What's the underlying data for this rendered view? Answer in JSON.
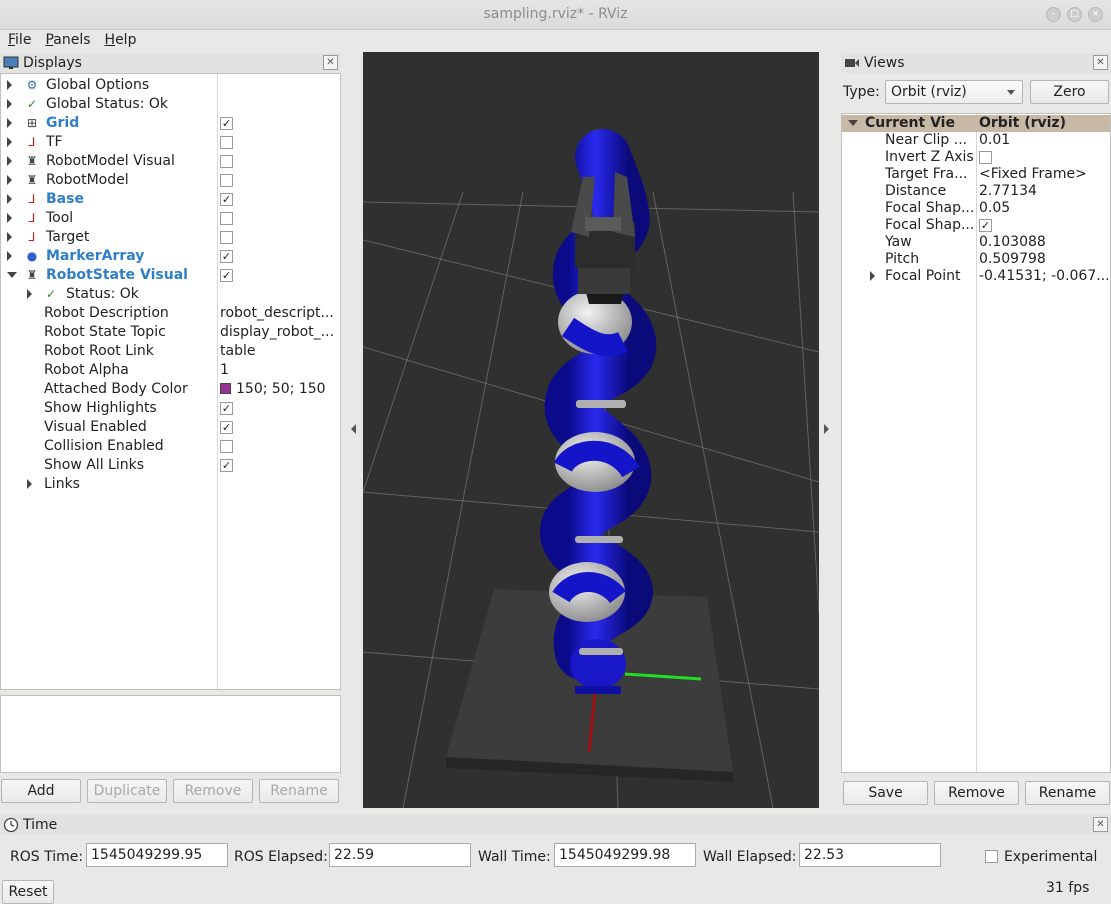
{
  "window": {
    "title": "sampling.rviz* - RViz"
  },
  "menu": [
    {
      "label": "File",
      "mnemonic": "F",
      "rest": "ile"
    },
    {
      "label": "Panels",
      "mnemonic": "P",
      "rest": "anels"
    },
    {
      "label": "Help",
      "mnemonic": "H",
      "rest": "elp"
    }
  ],
  "displays": {
    "title": "Displays",
    "items": [
      {
        "label": "Global Options",
        "icon": "gear-icon",
        "expanded": false,
        "checked": null,
        "highlight": false
      },
      {
        "label": "Global Status: Ok",
        "icon": "check-icon",
        "expanded": false,
        "checked": null,
        "highlight": false
      },
      {
        "label": "Grid",
        "icon": "grid-icon",
        "expanded": false,
        "checked": true,
        "highlight": true
      },
      {
        "label": "TF",
        "icon": "axes-icon",
        "expanded": false,
        "checked": false,
        "highlight": false
      },
      {
        "label": "RobotModel Visual",
        "icon": "robot-icon",
        "expanded": false,
        "checked": false,
        "highlight": false
      },
      {
        "label": "RobotModel",
        "icon": "robot-icon",
        "expanded": false,
        "checked": false,
        "highlight": false
      },
      {
        "label": "Base",
        "icon": "axes-icon",
        "expanded": false,
        "checked": true,
        "highlight": true
      },
      {
        "label": "Tool",
        "icon": "axes-icon",
        "expanded": false,
        "checked": false,
        "highlight": false
      },
      {
        "label": "Target",
        "icon": "axes-icon",
        "expanded": false,
        "checked": false,
        "highlight": false
      },
      {
        "label": "MarkerArray",
        "icon": "marker-icon",
        "expanded": false,
        "checked": true,
        "highlight": true
      },
      {
        "label": "RobotState Visual",
        "icon": "robot-icon",
        "expanded": true,
        "checked": true,
        "highlight": true
      }
    ],
    "children": [
      {
        "label": "Status: Ok",
        "type": "status"
      },
      {
        "label": "Robot Description",
        "value": "robot_descript..."
      },
      {
        "label": "Robot State Topic",
        "value": "display_robot_..."
      },
      {
        "label": "Robot Root Link",
        "value": "table"
      },
      {
        "label": "Robot Alpha",
        "value": "1"
      },
      {
        "label": "Attached Body Color",
        "value": "150; 50; 150",
        "color": "#963296"
      },
      {
        "label": "Show Highlights",
        "checked": true
      },
      {
        "label": "Visual Enabled",
        "checked": true
      },
      {
        "label": "Collision Enabled",
        "checked": false
      },
      {
        "label": "Show All Links",
        "checked": true
      },
      {
        "label": "Links",
        "type": "group"
      }
    ],
    "buttons": {
      "add": "Add",
      "duplicate": "Duplicate",
      "remove": "Remove",
      "rename": "Rename"
    }
  },
  "views": {
    "title": "Views",
    "type_label": "Type:",
    "type_value": "Orbit (rviz)",
    "zero_label": "Zero",
    "header": {
      "name": "Current View",
      "value": "Orbit (rviz)"
    },
    "props": [
      {
        "label": "Near Clip ...",
        "value": "0.01"
      },
      {
        "label": "Invert Z Axis",
        "checked": false
      },
      {
        "label": "Target Fra...",
        "value": "<Fixed Frame>"
      },
      {
        "label": "Distance",
        "value": "2.77134"
      },
      {
        "label": "Focal Shap...",
        "value": "0.05"
      },
      {
        "label": "Focal Shap...",
        "checked": true
      },
      {
        "label": "Yaw",
        "value": "0.103088"
      },
      {
        "label": "Pitch",
        "value": "0.509798"
      },
      {
        "label": "Focal Point",
        "value": "-0.41531; -0.067...",
        "expandable": true
      }
    ],
    "buttons": {
      "save": "Save",
      "remove": "Remove",
      "rename": "Rename"
    }
  },
  "time": {
    "title": "Time",
    "ros_time_label": "ROS Time:",
    "ros_time": "1545049299.95",
    "ros_elapsed_label": "ROS Elapsed:",
    "ros_elapsed": "22.59",
    "wall_time_label": "Wall Time:",
    "wall_time": "1545049299.98",
    "wall_elapsed_label": "Wall Elapsed:",
    "wall_elapsed": "22.53",
    "experimental_label": "Experimental",
    "experimental_checked": false,
    "reset_label": "Reset",
    "fps": "31 fps"
  },
  "colors": {
    "robot_link": "#1414c8",
    "robot_joint": "#b4b4b4",
    "background": "#303030",
    "grid": "#a0a0a0"
  }
}
